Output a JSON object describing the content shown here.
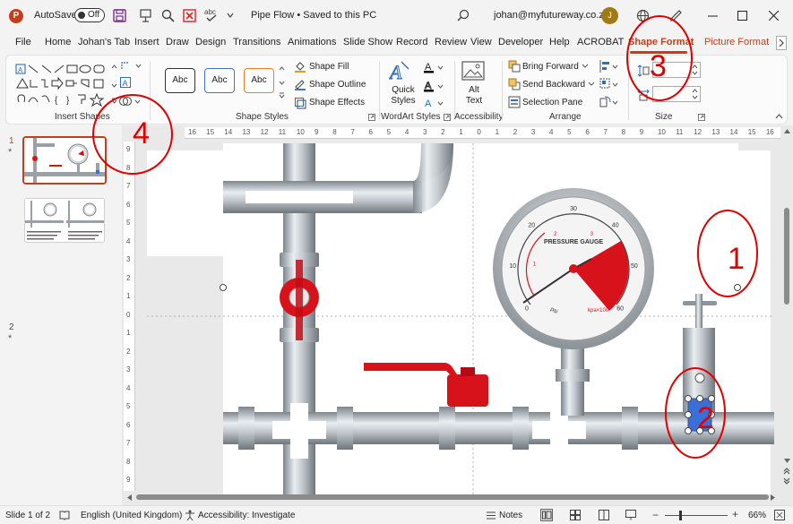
{
  "titlebar": {
    "app_letter": "P",
    "autosave_label": "AutoSave",
    "autosave_state": "Off",
    "doc_title": "Pipe Flow • Saved to this PC",
    "account": "johan@myfutureway.co.za",
    "avatar_letter": "J"
  },
  "tabs": [
    "File",
    "Home",
    "Johan's Tab",
    "Insert",
    "Draw",
    "Design",
    "Transitions",
    "Animations",
    "Slide Show",
    "Record",
    "Review",
    "View",
    "Developer",
    "Help",
    "ACROBAT",
    "Shape Format",
    "Picture Format"
  ],
  "ribbon": {
    "groups": {
      "insert_shapes": "Insert Shapes",
      "shape_styles": "Shape Styles",
      "wordart_styles": "WordArt Styles",
      "accessibility": "Accessibility",
      "arrange": "Arrange",
      "size": "Size"
    },
    "style_swatch": "Abc",
    "shape_fill": "Shape Fill",
    "shape_outline": "Shape Outline",
    "shape_effects": "Shape Effects",
    "quick_styles": "Quick Styles",
    "alt_text": "Alt Text",
    "bring_forward": "Bring Forward",
    "send_backward": "Send Backward",
    "selection_pane": "Selection Pane"
  },
  "thumbs": {
    "slide_numbers": [
      "1",
      "2"
    ],
    "star": "*"
  },
  "rulers": {
    "top": [
      "16",
      "15",
      "14",
      "13",
      "12",
      "11",
      "10",
      "9",
      "8",
      "7",
      "6",
      "5",
      "4",
      "3",
      "2",
      "1",
      "0",
      "1",
      "2",
      "3",
      "4",
      "5",
      "6",
      "7",
      "8",
      "9",
      "10",
      "11",
      "12",
      "13",
      "14",
      "15",
      "16"
    ],
    "left": [
      "9",
      "8",
      "7",
      "6",
      "5",
      "4",
      "3",
      "2",
      "1",
      "0",
      "1",
      "2",
      "3",
      "4",
      "5",
      "6",
      "7",
      "8",
      "9"
    ]
  },
  "gauge": {
    "title": "PRESSURE GAUGE",
    "ticks": [
      "0",
      "10",
      "20",
      "30",
      "40",
      "50",
      "60"
    ],
    "inner_ticks": [
      "1",
      "2",
      "3",
      "4"
    ],
    "unit_left": "psi",
    "unit_right": "kpa×100"
  },
  "annotations": [
    "1",
    "2",
    "3",
    "4"
  ],
  "status": {
    "slide_info": "Slide 1 of 2",
    "language": "English (United Kingdom)",
    "accessibility": "Accessibility: Investigate",
    "notes": "Notes",
    "zoom": "66%"
  },
  "colors": {
    "accent": "#c43e1c",
    "annotation": "#e00000"
  }
}
